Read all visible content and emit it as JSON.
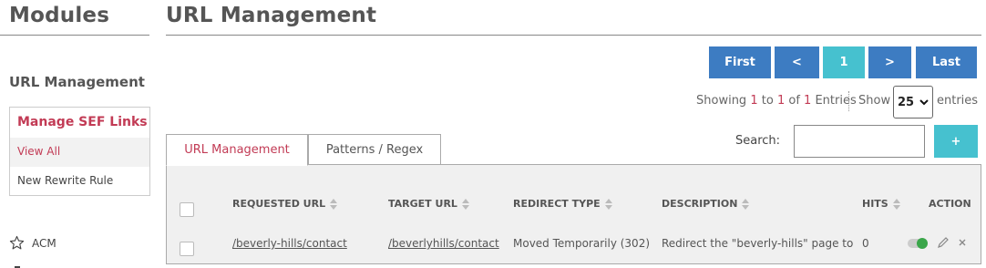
{
  "sidebar": {
    "title": "Modules",
    "section": "URL Management",
    "box": {
      "title": "Manage SEF Links",
      "items": [
        {
          "label": "View All"
        },
        {
          "label": "New Rewrite Rule"
        }
      ]
    },
    "other": [
      {
        "label": "ACM",
        "icon": "star-icon"
      }
    ]
  },
  "main": {
    "title": "URL Management",
    "pagination": {
      "first": "First",
      "prev": "<",
      "current": "1",
      "next": ">",
      "last": "Last"
    },
    "summary": {
      "prefix": "Showing",
      "from": "1",
      "to_word": "to",
      "to": "1",
      "of_word": "of",
      "total": "1",
      "suffix": "Entries"
    },
    "page_size": {
      "label": "Show",
      "value": "25",
      "suffix": "entries"
    },
    "search": {
      "label": "Search:",
      "value": "",
      "placeholder": ""
    },
    "add_label": "+",
    "tabs": [
      {
        "label": "URL Management",
        "active": true
      },
      {
        "label": "Patterns / Regex",
        "active": false
      }
    ],
    "table": {
      "columns": [
        "REQUESTED URL",
        "TARGET URL",
        "REDIRECT TYPE",
        "DESCRIPTION",
        "HITS",
        "ACTION"
      ],
      "rows": [
        {
          "requested": "/beverly-hills/contact",
          "target": "/beverlyhills/contact",
          "type": "Moved Temporarily (302)",
          "description": "Redirect the \"beverly-hills\" page to",
          "hits": "0",
          "enabled": true
        }
      ]
    }
  },
  "colors": {
    "accent": "#c23b55",
    "primary": "#3d7cc2",
    "info": "#46c1cf",
    "toggle_on": "#3aa64a"
  }
}
